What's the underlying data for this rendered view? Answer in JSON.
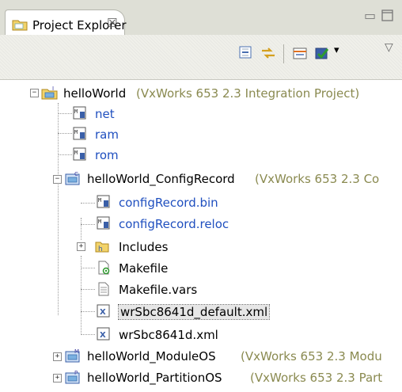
{
  "view": {
    "title": "Project Explorer",
    "close_glyph": "☒"
  },
  "window_buttons": {
    "minimize": "▭",
    "maximize": "🗖"
  },
  "toolbar": {
    "menu_arrow": "▾",
    "view_menu": "▽"
  },
  "tree": {
    "project": {
      "name": "helloWorld",
      "decoration": "(VxWorks 653 2.3 Integration Project)"
    },
    "net": "net",
    "ram": "ram",
    "rom": "rom",
    "config_record": {
      "name": "helloWorld_ConfigRecord",
      "decoration": "(VxWorks 653 2.3 Co"
    },
    "config_bin": "configRecord.bin",
    "config_reloc": "configRecord.reloc",
    "includes": "Includes",
    "makefile": "Makefile",
    "makefile_vars": "Makefile.vars",
    "xml_default": "wrSbc8641d_default.xml",
    "xml": "wrSbc8641d.xml",
    "module_os": {
      "name": "helloWorld_ModuleOS",
      "decoration": "(VxWorks 653 2.3 Modu"
    },
    "partition_os": {
      "name": "helloWorld_PartitionOS",
      "decoration": "(VxWorks 653 2.3 Part"
    }
  },
  "expander": {
    "expanded": "−",
    "collapsed": "+"
  }
}
